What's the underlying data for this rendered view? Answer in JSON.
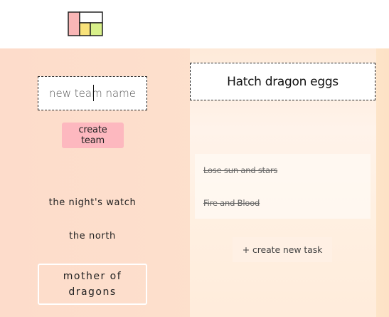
{
  "app": {
    "logo_icon": "app-logo-icon",
    "logo_colors": {
      "pink": "#f9b6b6",
      "yellow": "#f8e27a",
      "green": "#d8f08a",
      "white": "#ffffff",
      "outline": "#222222"
    }
  },
  "teams": {
    "new_team_placeholder": "new team name",
    "create_label": "create team",
    "items": [
      {
        "label": "the night's watch",
        "selected": false
      },
      {
        "label": "the north",
        "selected": false
      },
      {
        "label": "mother of dragons",
        "selected": true
      }
    ]
  },
  "tasks": {
    "title": "Hatch dragon eggs",
    "items": [
      {
        "label": "Lose sun and stars",
        "done": true
      },
      {
        "label": "Fire and Blood",
        "done": true
      }
    ],
    "create_label": "+ create new task"
  },
  "colors": {
    "background": "#fddccb",
    "accent_button": "#fdb8bf"
  }
}
